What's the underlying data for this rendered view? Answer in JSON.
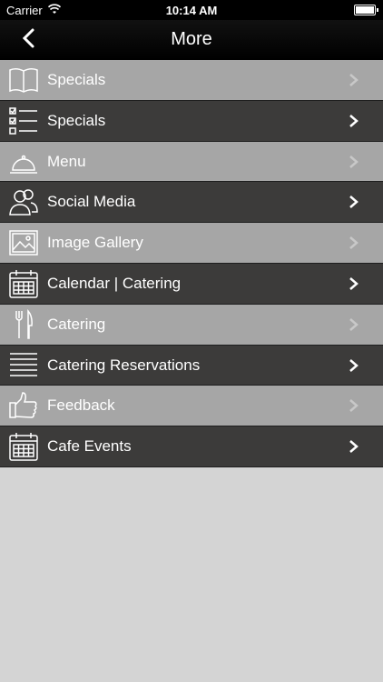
{
  "status": {
    "carrier": "Carrier",
    "time": "10:14 AM"
  },
  "nav": {
    "title": "More"
  },
  "items": [
    {
      "label": "Specials",
      "icon": "book-icon"
    },
    {
      "label": "Specials",
      "icon": "checklist-icon"
    },
    {
      "label": "Menu",
      "icon": "cloche-icon"
    },
    {
      "label": "Social Media",
      "icon": "users-icon"
    },
    {
      "label": "Image Gallery",
      "icon": "image-icon"
    },
    {
      "label": "Calendar | Catering",
      "icon": "calendar-icon"
    },
    {
      "label": "Catering",
      "icon": "fork-knife-icon"
    },
    {
      "label": "Catering Reservations",
      "icon": "lines-icon"
    },
    {
      "label": "Feedback",
      "icon": "thumbs-up-icon"
    },
    {
      "label": "Cafe Events",
      "icon": "calendar-icon"
    }
  ]
}
